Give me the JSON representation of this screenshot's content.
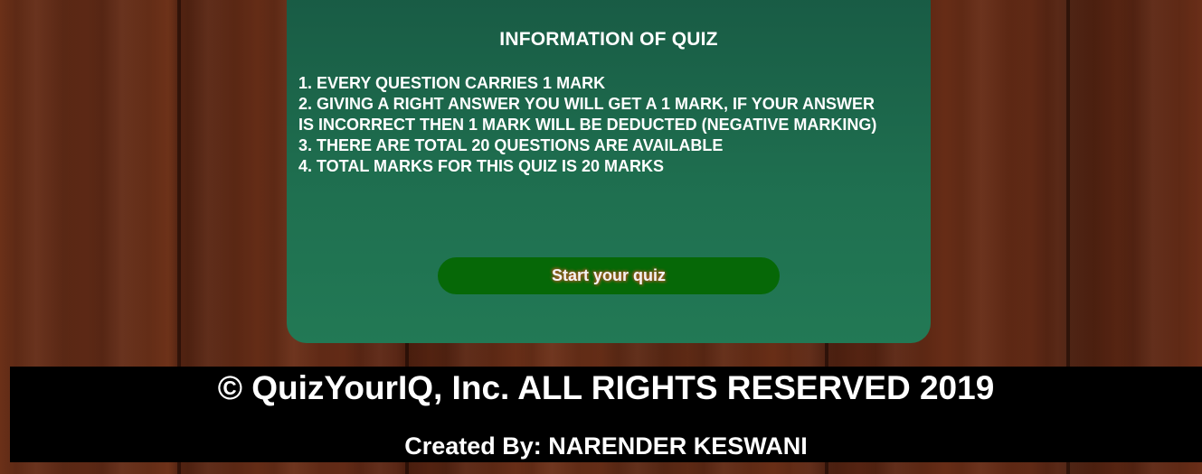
{
  "info": {
    "title": "INFORMATION OF QUIZ",
    "rules": [
      "1. EVERY QUESTION CARRIES 1 MARK",
      "2. GIVING A RIGHT ANSWER YOU WILL GET A 1 MARK, IF YOUR ANSWER IS INCORRECT THEN 1 MARK WILL BE DEDUCTED (NEGATIVE MARKING)",
      "3. THERE ARE TOTAL 20 QUESTIONS ARE AVAILABLE",
      "4. TOTAL MARKS FOR THIS QUIZ IS 20 MARKS"
    ],
    "start_label": "Start your quiz"
  },
  "footer": {
    "copyright": "© QuizYourIQ, Inc. ALL RIGHTS RESERVED 2019",
    "credit": "Created By: NARENDER KESWANI"
  },
  "colors": {
    "panel": "#1d6a4c",
    "button": "#066807",
    "footer": "#000000",
    "wood": "#5a2a17"
  }
}
